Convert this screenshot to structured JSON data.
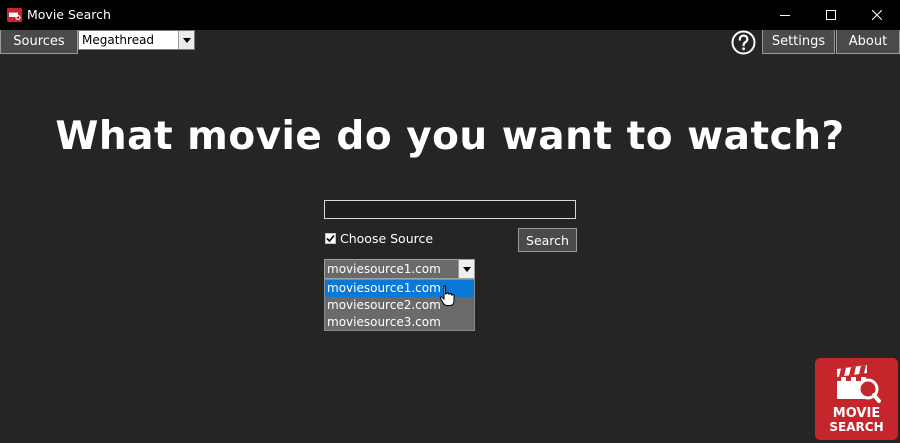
{
  "window": {
    "title": "Movie Search"
  },
  "toolbar": {
    "sources_label": "Sources",
    "source_select_value": "Megathread",
    "settings_label": "Settings",
    "about_label": "About"
  },
  "main": {
    "headline": "What movie do you want to watch?",
    "search_input_value": "",
    "choose_source_label": "Choose Source",
    "choose_source_checked": true,
    "search_button_label": "Search",
    "source_combo_value": "moviesource1.com",
    "source_options": [
      "moviesource1.com",
      "moviesource2.com",
      "moviesource3.com"
    ]
  },
  "logo": {
    "line1": "MOVIE",
    "line2": "SEARCH"
  },
  "colors": {
    "background": "#252525",
    "accent": "#0a78d7",
    "brand": "#c4262c"
  }
}
